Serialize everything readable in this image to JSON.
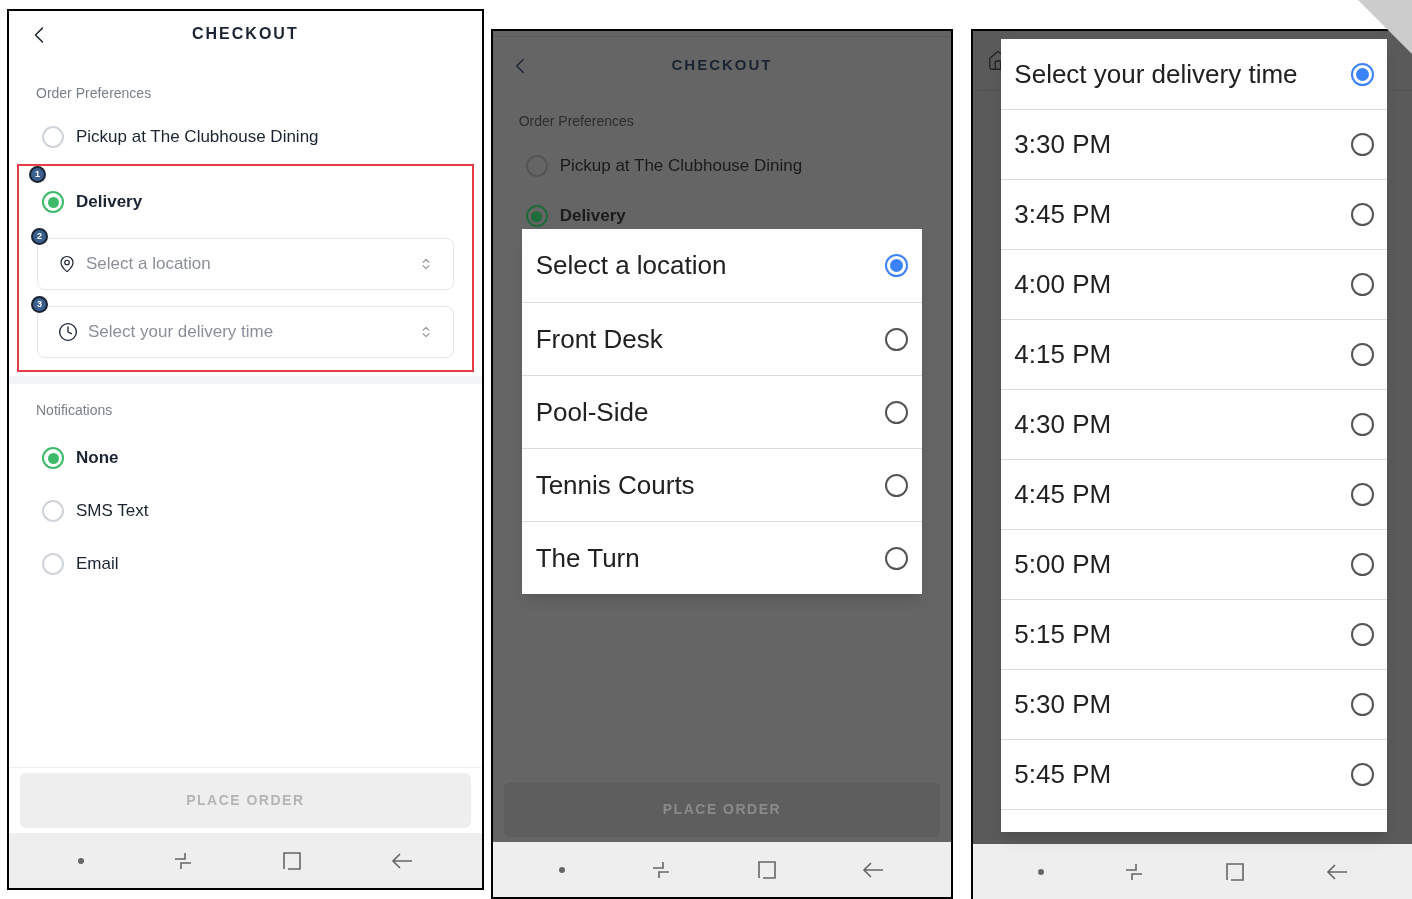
{
  "screen_1": {
    "title": "CHECKOUT",
    "order_section": {
      "label": "Order Preferences",
      "options": [
        {
          "label": "Pickup at The Clubhouse Dining",
          "selected": false
        },
        {
          "label": "Delivery",
          "selected": true,
          "badge": "1"
        }
      ]
    },
    "fields": [
      {
        "kind": "location",
        "placeholder": "Select a location",
        "badge": "2"
      },
      {
        "kind": "time",
        "placeholder": "Select your delivery time",
        "badge": "3"
      }
    ],
    "notifications": {
      "label": "Notifications",
      "options": [
        {
          "label": "None",
          "selected": true
        },
        {
          "label": "SMS Text",
          "selected": false
        },
        {
          "label": "Email",
          "selected": false
        }
      ]
    },
    "button": {
      "label": "PLACE ORDER",
      "disabled": true
    }
  },
  "screen_2": {
    "background": {
      "title": "CHECKOUT",
      "section": "Order Preferences",
      "options": [
        {
          "label": "Pickup at The Clubhouse Dining",
          "selected": false
        },
        {
          "label": "Delivery",
          "selected": true
        }
      ],
      "button": "PLACE ORDER"
    },
    "picker": {
      "options": [
        {
          "label": "Select a location",
          "selected": true
        },
        {
          "label": "Front Desk",
          "selected": false
        },
        {
          "label": "Pool-Side",
          "selected": false
        },
        {
          "label": "Tennis Courts",
          "selected": false
        },
        {
          "label": "The Turn",
          "selected": false
        }
      ]
    }
  },
  "screen_3": {
    "picker": {
      "options": [
        {
          "label": "Select your delivery time",
          "selected": true
        },
        {
          "label": "3:30 PM",
          "selected": false
        },
        {
          "label": "3:45 PM",
          "selected": false
        },
        {
          "label": "4:00 PM",
          "selected": false
        },
        {
          "label": "4:15 PM",
          "selected": false
        },
        {
          "label": "4:30 PM",
          "selected": false
        },
        {
          "label": "4:45 PM",
          "selected": false
        },
        {
          "label": "5:00 PM",
          "selected": false
        },
        {
          "label": "5:15 PM",
          "selected": false
        },
        {
          "label": "5:30 PM",
          "selected": false
        },
        {
          "label": "5:45 PM",
          "selected": false
        }
      ]
    }
  }
}
